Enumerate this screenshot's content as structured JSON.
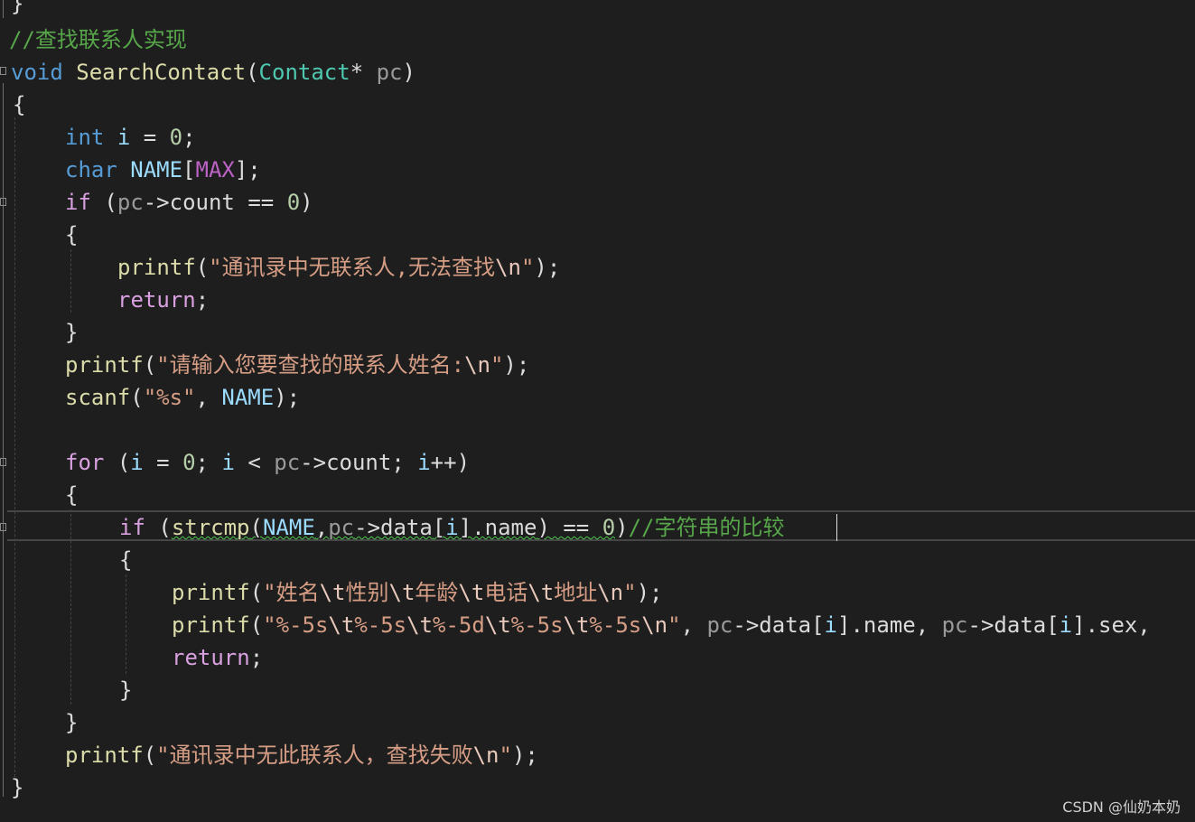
{
  "editor": {
    "language": "C",
    "theme": "dark",
    "lines": {
      "l00": "}",
      "l01_comment": "//查找联系人实现",
      "l02": {
        "a": "void",
        "b": "SearchContact",
        "c": "(",
        "d": "Contact",
        "e": "*",
        "f": "pc",
        "g": ")"
      },
      "l03": "{",
      "l04": {
        "a": "int",
        "b": "i",
        "c": "=",
        "d": "0",
        "e": ";"
      },
      "l05": {
        "a": "char",
        "b": "NAME",
        "c": "[",
        "d": "MAX",
        "e": "];"
      },
      "l06": {
        "a": "if",
        "b": "(",
        "c": "pc",
        "d": "->",
        "e": "count",
        "f": "==",
        "g": "0",
        "h": ")"
      },
      "l07": "{",
      "l08": {
        "a": "printf",
        "b": "(",
        "c": "\"通讯录中无联系人,无法查找",
        "d": "\\n",
        "e": "\"",
        "f": ");"
      },
      "l09": {
        "a": "return",
        "b": ";"
      },
      "l10": "}",
      "l11": {
        "a": "printf",
        "b": "(",
        "c": "\"请输入您要查找的联系人姓名:",
        "d": "\\n",
        "e": "\"",
        "f": ");"
      },
      "l12": {
        "a": "scanf",
        "b": "(",
        "c": "\"%s\"",
        "d": ",",
        "e": "NAME",
        "f": ");"
      },
      "l14": {
        "a": "for",
        "b": "(",
        "c": "i",
        "d": "=",
        "e": "0",
        "f": ";",
        "g": "i",
        "h": "<",
        "i": "pc",
        "j": "->",
        "k": "count",
        "l": ";",
        "m": "i",
        "n": "++",
        "o": ")"
      },
      "l15": "{",
      "l16": {
        "a": "if",
        "b": "(",
        "c": "strcmp",
        "d": "(",
        "e": "NAME",
        "f": ",",
        "g": "pc",
        "h": "->",
        "i": "data",
        "j": "[",
        "k": "i",
        "l": "]",
        "m": ".name",
        "n": ")",
        "o": "==",
        "p": "0",
        "q": ")",
        "r": "//字符串的比较"
      },
      "l17": "{",
      "l18": {
        "a": "printf",
        "b": "(",
        "c": "\"姓名",
        "d": "\\t",
        "e": "性别",
        "f": "\\t",
        "g": "年龄",
        "h": "\\t",
        "i": "电话",
        "j": "\\t",
        "k": "地址",
        "l": "\\n",
        "m": "\"",
        "n": ");"
      },
      "l19": {
        "a": "printf",
        "b": "(",
        "c": "\"%-5s",
        "d": "\\t",
        "e": "%-5s",
        "f": "\\t",
        "g": "%-5d",
        "h": "\\t",
        "i": "%-5s",
        "j": "\\t",
        "k": "%-5s",
        "l": "\\n",
        "m": "\"",
        "n": ",",
        "o": "pc",
        "p": "->",
        "q": "data",
        "r": "[",
        "s": "i",
        "t": "].name,",
        "u": "pc",
        "v": "->",
        "w": "data",
        "x": "[",
        "y": "i",
        "z": "].sex,"
      },
      "l20": {
        "a": "return",
        "b": ";"
      },
      "l21": "}",
      "l22": "}",
      "l23": {
        "a": "printf",
        "b": "(",
        "c": "\"通讯录中无此联系人，查找失败",
        "d": "\\n",
        "e": "\"",
        "f": ");"
      },
      "l24": "}"
    }
  },
  "watermark": "CSDN @仙奶本奶"
}
